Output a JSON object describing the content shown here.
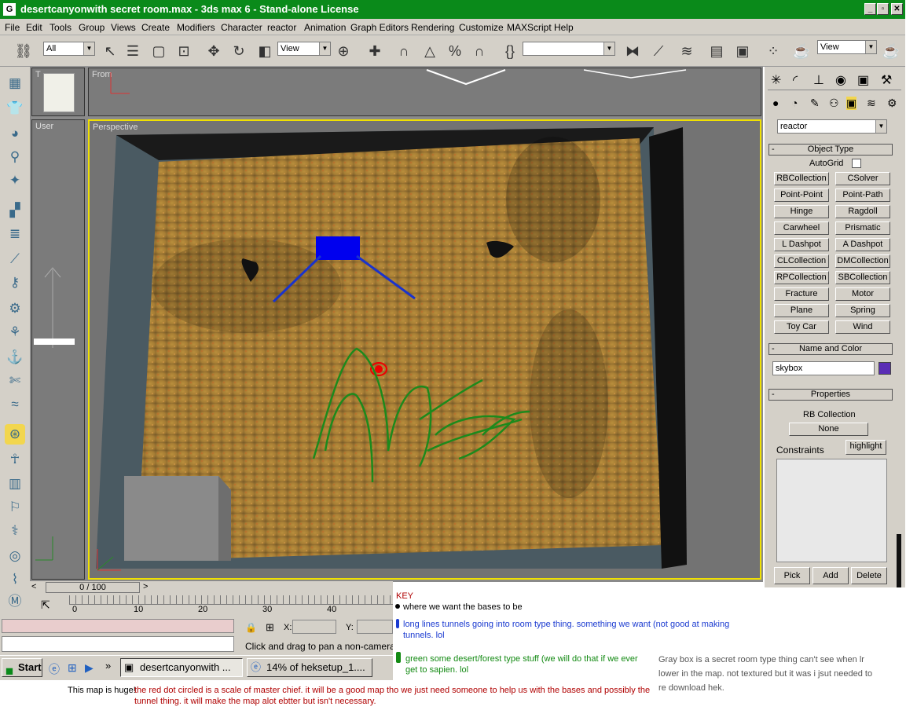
{
  "window": {
    "title": "desertcanyonwith secret room.max - 3ds max 6 - Stand-alone License",
    "app_icon": "3dsmax-logo",
    "controls": [
      "_",
      "▫",
      "✕"
    ]
  },
  "menu": [
    "File",
    "Edit",
    "Tools",
    "Group",
    "Views",
    "Create",
    "Modifiers",
    "Character",
    "reactor",
    "Animation",
    "Graph Editors",
    "Rendering",
    "Customize",
    "MAXScript",
    "Help"
  ],
  "toolbar": {
    "selection_filter": "All",
    "ref_coord": "View",
    "named_sel": "",
    "render_view": "View"
  },
  "viewports": {
    "top_left": "T",
    "front": "From",
    "left": "User",
    "perspective": "Perspective"
  },
  "command_panel": {
    "category": "reactor",
    "object_type": {
      "header": "Object Type",
      "autogrid": "AutoGrid",
      "buttons": [
        "RBCollection",
        "CSolver",
        "Point-Point",
        "Point-Path",
        "Hinge",
        "Ragdoll",
        "Carwheel",
        "Prismatic",
        "L Dashpot",
        "A Dashpot",
        "CLCollection",
        "DMCollection",
        "RPCollection",
        "SBCollection",
        "Fracture",
        "Motor",
        "Plane",
        "Spring",
        "Toy Car",
        "Wind"
      ]
    },
    "name_color": {
      "header": "Name and Color",
      "name": "skybox",
      "color": "#5a2db5"
    },
    "properties": {
      "header": "Properties",
      "rb_collection": "RB Collection",
      "none_btn": "None",
      "constraints": "Constraints",
      "highlight": "highlight",
      "pick": "Pick",
      "add": "Add",
      "delete": "Delete"
    }
  },
  "timeline": {
    "frame": "0 / 100",
    "ticks": [
      "0",
      "10",
      "20",
      "30",
      "40"
    ]
  },
  "status": {
    "x_label": "X:",
    "y_label": "Y:",
    "prompt": "Click and drag to pan a non-camera vie"
  },
  "taskbar": {
    "start": "Start",
    "tasks": [
      "desertcanyonwith ...",
      "14% of heksetup_1...."
    ]
  },
  "annotations": {
    "key_title": "KEY",
    "black": "where we want the bases to be",
    "blue": "long lines tunnels going into room type thing. something we want (not good at making tunnels. lol",
    "green": "green some desert/forest type stuff (we will do that if we ever get to sapien. lol",
    "gray": "Gray box is a secret room type thing can't see when lr lower in the map. not textured but it was i jsut needed to re download hek.",
    "huge": "This map is huge!",
    "red": "the red dot circled is a scale of master chief. it will be a good map tho we just need someone to help us with the bases and possibly the tunnel thing. it will make the map alot ebtter but isn't necessary."
  },
  "colors": {
    "title_green": "#0a8a1a",
    "annot_red": "#b00000",
    "annot_blue": "#1a3ad0",
    "annot_green": "#138a13"
  }
}
